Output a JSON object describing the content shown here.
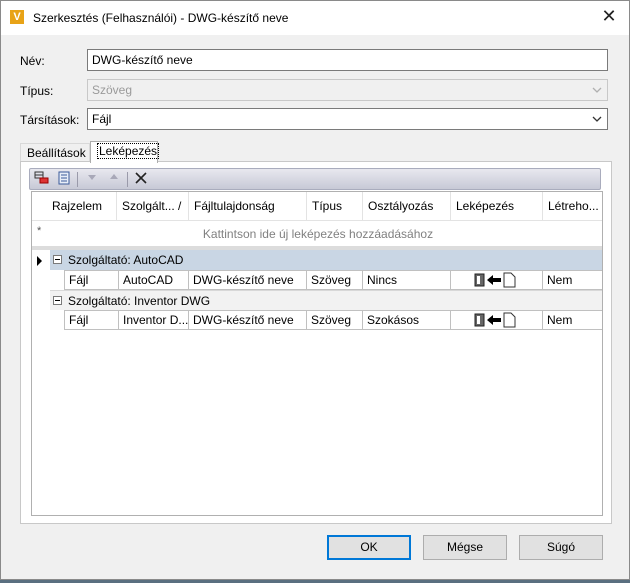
{
  "window": {
    "title": "Szerkesztés (Felhasználói) - DWG-készítő neve",
    "icon_letter": "V",
    "close_glyph": "✕"
  },
  "form": {
    "name_label": "Név:",
    "name_value": "DWG-készítő neve",
    "type_label": "Típus:",
    "type_value": "Szöveg",
    "assoc_label": "Társítások:",
    "assoc_value": "Fájl"
  },
  "tabs": [
    {
      "label": "Beállítások",
      "active": false
    },
    {
      "label": "Leképezés",
      "active": true
    }
  ],
  "grid": {
    "columns": [
      "Rajzelem",
      "Szolgált...",
      "/",
      "Fájltulajdonság",
      "Típus",
      "Osztályozás",
      "Leképezés",
      "Létreho..."
    ],
    "new_row_marker": "*",
    "new_row_text": "Kattintson ide új leképezés hozzáadásához",
    "groups": [
      {
        "label": "Szolgáltató: AutoCAD",
        "selected": true,
        "row": [
          "Fájl",
          "AutoCAD",
          "DWG-készítő neve",
          "Szöveg",
          "Nincs",
          "",
          "Nem"
        ]
      },
      {
        "label": "Szolgáltató: Inventor DWG",
        "selected": false,
        "row": [
          "Fájl",
          "Inventor D...",
          "DWG-készítő neve",
          "Szöveg",
          "Szokásos",
          "",
          "Nem"
        ]
      }
    ]
  },
  "buttons": {
    "ok": "OK",
    "cancel": "Mégse",
    "help": "Súgó"
  },
  "colors": {
    "selected_group": "#c9d6e4",
    "default_button_border": "#0078d7",
    "toolbar_gradient_end": "#c7c9d6"
  }
}
